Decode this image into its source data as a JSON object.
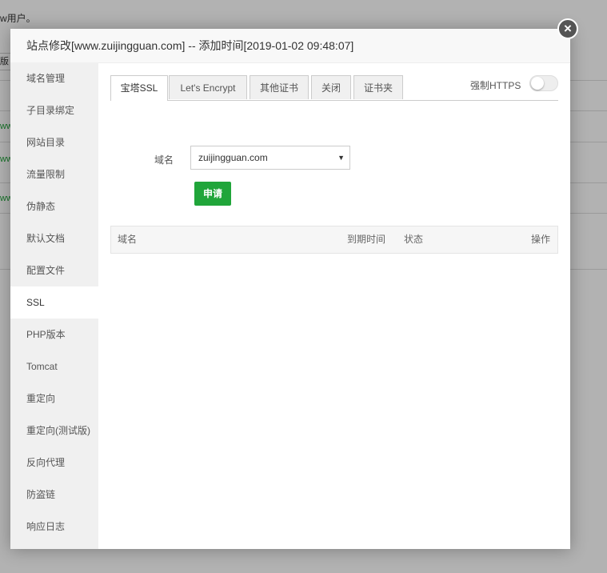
{
  "background": {
    "top_text": "w用户。",
    "left_box_text": "版本",
    "left_fragments": [
      "ww",
      "ww",
      "ww"
    ]
  },
  "dialog": {
    "title": "站点修改[www.zuijingguan.com] -- 添加时间[2019-01-02 09:48:07]",
    "close_icon": "×"
  },
  "sidebar": {
    "items": [
      {
        "label": "域名管理"
      },
      {
        "label": "子目录绑定"
      },
      {
        "label": "网站目录"
      },
      {
        "label": "流量限制"
      },
      {
        "label": "伪静态"
      },
      {
        "label": "默认文档"
      },
      {
        "label": "配置文件"
      },
      {
        "label": "SSL"
      },
      {
        "label": "PHP版本"
      },
      {
        "label": "Tomcat"
      },
      {
        "label": "重定向"
      },
      {
        "label": "重定向(测试版)"
      },
      {
        "label": "反向代理"
      },
      {
        "label": "防盗链"
      },
      {
        "label": "响应日志"
      }
    ],
    "active_index": 7
  },
  "tabs": [
    {
      "label": "宝塔SSL"
    },
    {
      "label": "Let's Encrypt"
    },
    {
      "label": "其他证书"
    },
    {
      "label": "关闭"
    },
    {
      "label": "证书夹"
    }
  ],
  "force_https": {
    "label": "强制HTTPS",
    "enabled": false
  },
  "form": {
    "domain_label": "域名",
    "domain_value": "zuijingguan.com",
    "select_arrow": "▼",
    "apply_label": "申请"
  },
  "table": {
    "headers": {
      "domain": "域名",
      "expiry": "到期时间",
      "status": "状态",
      "action": "操作"
    }
  },
  "colors": {
    "accent_green": "#20a53a",
    "sidebar_bg": "#f0f0f0",
    "overlay": "rgba(0,0,0,0.3)"
  }
}
